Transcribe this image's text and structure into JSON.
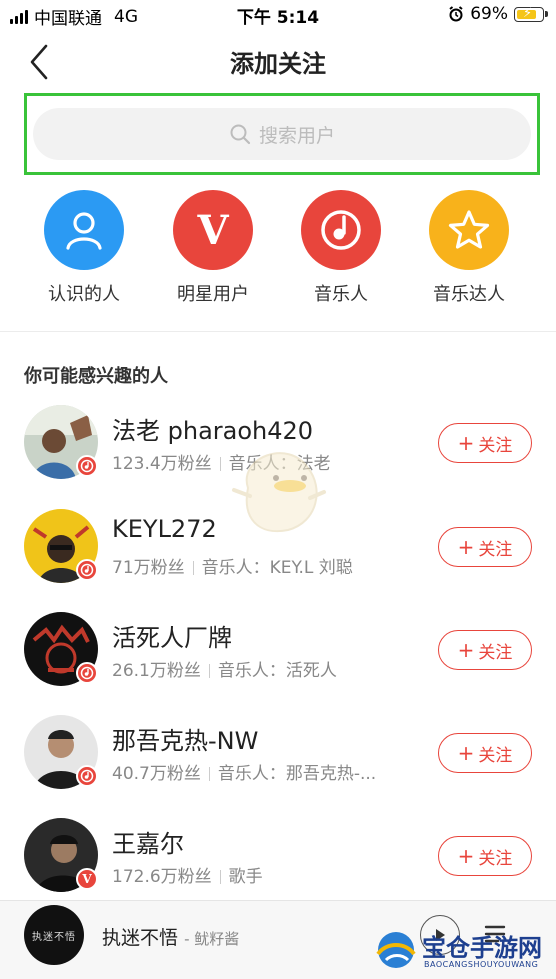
{
  "status_bar": {
    "carrier": "中国联通",
    "network": "4G",
    "time": "下午 5:14",
    "battery": "69%"
  },
  "nav": {
    "title": "添加关注"
  },
  "search": {
    "placeholder": "搜索用户"
  },
  "categories": [
    {
      "label": "认识的人",
      "icon": "person-icon",
      "color": "#2b9af3"
    },
    {
      "label": "明星用户",
      "icon": "v-icon",
      "color": "#e8453c"
    },
    {
      "label": "音乐人",
      "icon": "music-note-icon",
      "color": "#e8453c"
    },
    {
      "label": "音乐达人",
      "icon": "star-icon",
      "color": "#f8b21b"
    }
  ],
  "section": {
    "title": "你可能感兴趣的人"
  },
  "users": [
    {
      "name": "法老 pharaoh420",
      "fans": "123.4万粉丝",
      "tag": "音乐人：法老",
      "badge": "music",
      "follow": "关注"
    },
    {
      "name": "KEYL272",
      "fans": "71万粉丝",
      "tag": "音乐人：KEY.L 刘聪",
      "badge": "music",
      "follow": "关注"
    },
    {
      "name": "活死人厂牌",
      "fans": "26.1万粉丝",
      "tag": "音乐人：活死人",
      "badge": "music",
      "follow": "关注"
    },
    {
      "name": "那吾克热-NW",
      "fans": "40.7万粉丝",
      "tag": "音乐人：那吾克热-...",
      "badge": "music",
      "follow": "关注"
    },
    {
      "name": "王嘉尔",
      "fans": "172.6万粉丝",
      "tag": "歌手",
      "badge": "V",
      "follow": "关注"
    }
  ],
  "player": {
    "song": "执迷不悟",
    "artist": "- 鱿籽酱",
    "cover_text": "执迷不悟"
  },
  "watermark": {
    "brand": "宝仓手游网",
    "sub": "BAOCANGSHOUYOUWANG"
  },
  "colors": {
    "accent_red": "#e8453c",
    "highlight_green": "#39c339",
    "blue": "#2b9af3",
    "yellow": "#f8b21b"
  }
}
